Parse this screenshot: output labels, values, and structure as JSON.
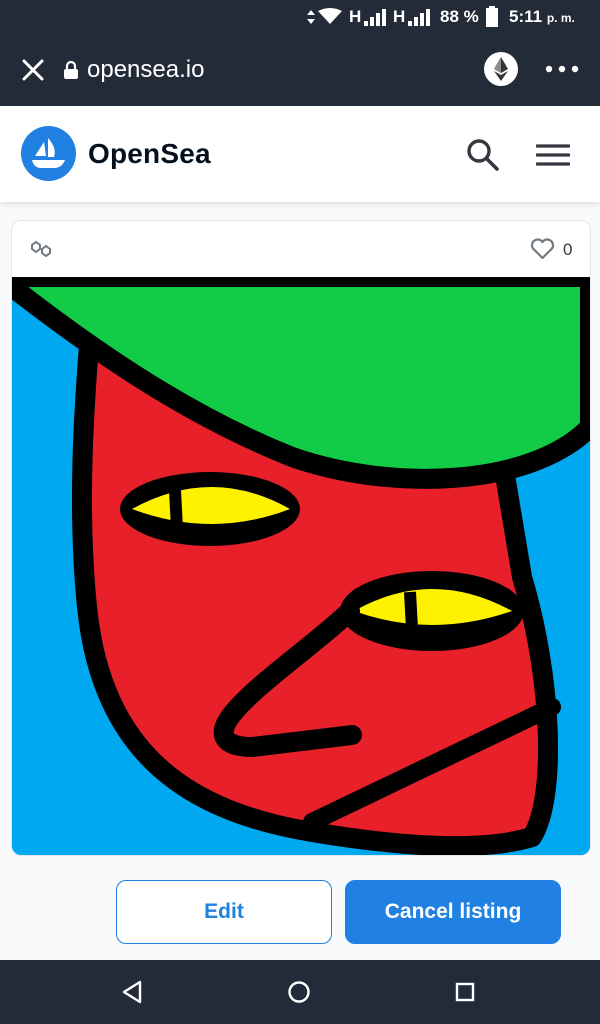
{
  "status_bar": {
    "network_1": "H",
    "network_2": "H",
    "battery_percent": "88 %",
    "time": "5:11",
    "time_suffix": "p. m."
  },
  "browser": {
    "url": "opensea.io",
    "icons": [
      "close-icon",
      "lock-icon",
      "ethereum-icon",
      "more-icon"
    ]
  },
  "header": {
    "brand_name": "OpenSea",
    "icons": [
      "opensea-logo",
      "search-icon",
      "menu-icon"
    ]
  },
  "card": {
    "like_count": "0",
    "icons": [
      "polygon-chain-icon",
      "heart-icon"
    ]
  },
  "artwork": {
    "background_color": "#00a8f0",
    "hat_color": "#12cc48",
    "face_color": "#e8202a",
    "eye_color": "#fff200",
    "outline_color": "#000000"
  },
  "actions": {
    "edit_label": "Edit",
    "cancel_label": "Cancel listing"
  },
  "colors": {
    "accent": "#2081e2",
    "chrome": "#232b38"
  }
}
